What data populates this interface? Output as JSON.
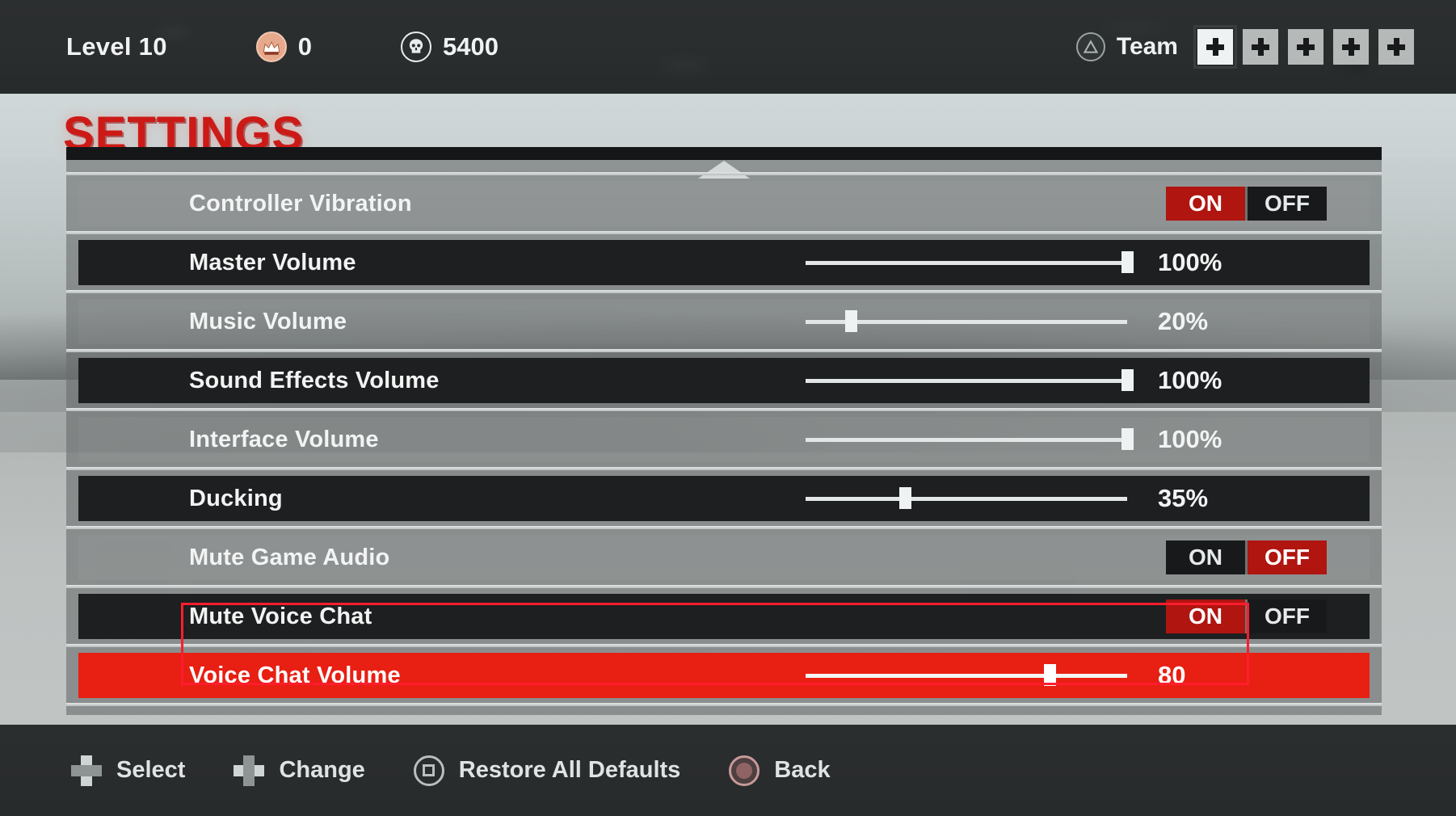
{
  "hud": {
    "level_label": "Level 10",
    "crown_icon": "crown-icon",
    "crown_value": "0",
    "skull_icon": "skull-icon",
    "skull_value": "5400",
    "team_label": "Team",
    "team_button_icon": "ps-triangle-icon",
    "slots": [
      {
        "icon": "plus-icon",
        "active": true
      },
      {
        "icon": "plus-icon",
        "active": false
      },
      {
        "icon": "plus-icon",
        "active": false
      },
      {
        "icon": "plus-icon",
        "active": false
      },
      {
        "icon": "plus-icon",
        "active": false
      }
    ]
  },
  "page": {
    "title": "SETTINGS",
    "scroll_up_icon": "chevron-up-icon"
  },
  "settings": {
    "rows": [
      {
        "label": "Controller Vibration",
        "type": "toggle",
        "on_label": "ON",
        "off_label": "OFF",
        "selected_option": "ON"
      },
      {
        "label": "Master Volume",
        "type": "slider",
        "value": 100,
        "value_label": "100%",
        "percent": 100
      },
      {
        "label": "Music Volume",
        "type": "slider",
        "value": 20,
        "value_label": "20%",
        "percent": 14
      },
      {
        "label": "Sound Effects Volume",
        "type": "slider",
        "value": 100,
        "value_label": "100%",
        "percent": 100
      },
      {
        "label": "Interface Volume",
        "type": "slider",
        "value": 100,
        "value_label": "100%",
        "percent": 100
      },
      {
        "label": "Ducking",
        "type": "slider",
        "value": 35,
        "value_label": "35%",
        "percent": 31
      },
      {
        "label": "Mute Game Audio",
        "type": "toggle",
        "on_label": "ON",
        "off_label": "OFF",
        "selected_option": "OFF"
      },
      {
        "label": "Mute Voice Chat",
        "type": "toggle",
        "on_label": "ON",
        "off_label": "OFF",
        "selected_option": "ON"
      },
      {
        "label": "Voice Chat Volume",
        "type": "slider",
        "value": 80,
        "value_label": "80",
        "percent": 76,
        "highlighted": true
      }
    ]
  },
  "footer": {
    "hints": [
      {
        "icon": "dpad-vertical-icon",
        "label": "Select"
      },
      {
        "icon": "dpad-horizontal-icon",
        "label": "Change"
      },
      {
        "icon": "ps-square-icon",
        "label": "Restore All Defaults"
      },
      {
        "icon": "ps-circle-icon",
        "label": "Back"
      }
    ]
  },
  "colors": {
    "accent_red": "#cc1a17",
    "highlight_red": "#e81f13",
    "toggle_active_red": "#b01510",
    "annotation_red": "#ff1d2d",
    "row_dark": "#1d1f20",
    "text_light": "#f2f4f4"
  }
}
